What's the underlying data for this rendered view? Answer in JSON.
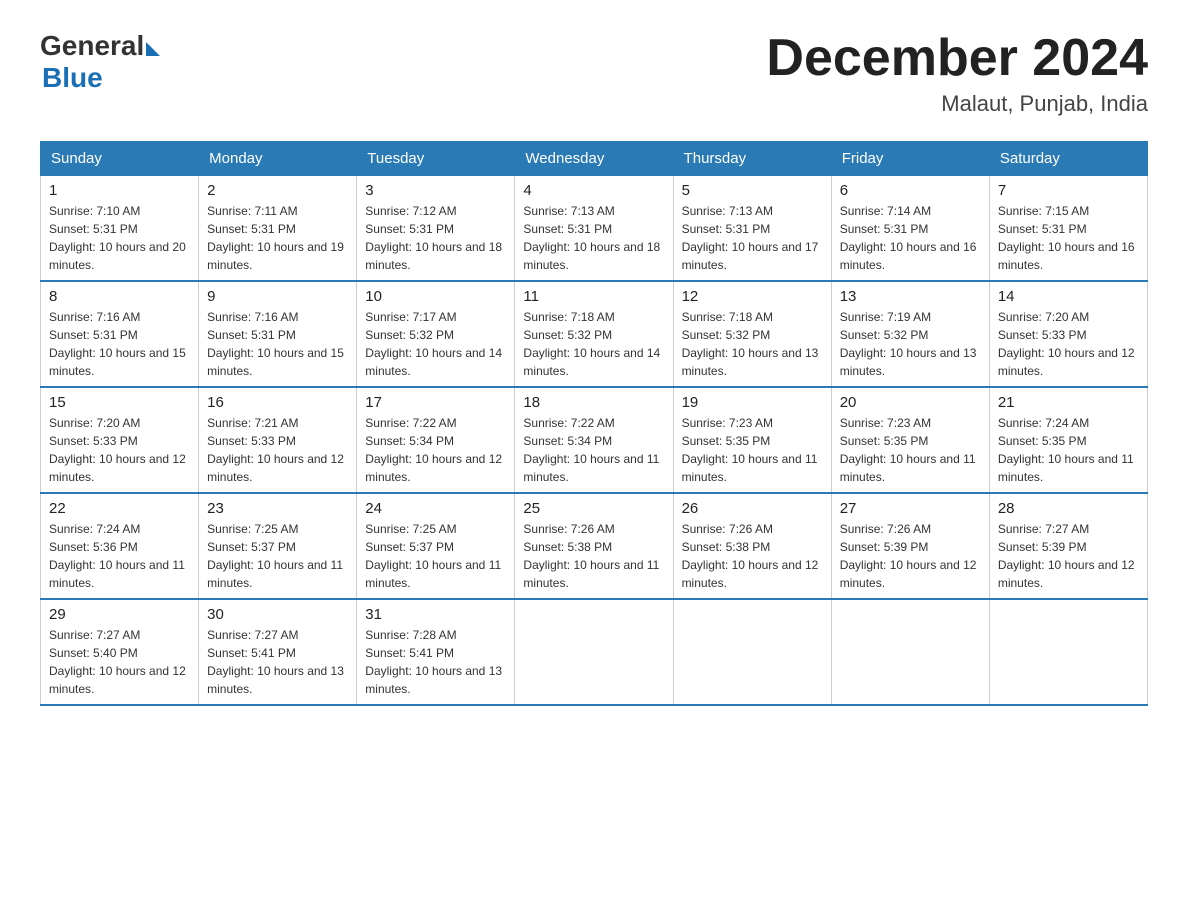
{
  "header": {
    "logo_general": "General",
    "logo_blue": "Blue",
    "month_title": "December 2024",
    "subtitle": "Malaut, Punjab, India"
  },
  "days_of_week": [
    "Sunday",
    "Monday",
    "Tuesday",
    "Wednesday",
    "Thursday",
    "Friday",
    "Saturday"
  ],
  "weeks": [
    [
      {
        "day": "1",
        "sunrise": "7:10 AM",
        "sunset": "5:31 PM",
        "daylight": "10 hours and 20 minutes."
      },
      {
        "day": "2",
        "sunrise": "7:11 AM",
        "sunset": "5:31 PM",
        "daylight": "10 hours and 19 minutes."
      },
      {
        "day": "3",
        "sunrise": "7:12 AM",
        "sunset": "5:31 PM",
        "daylight": "10 hours and 18 minutes."
      },
      {
        "day": "4",
        "sunrise": "7:13 AM",
        "sunset": "5:31 PM",
        "daylight": "10 hours and 18 minutes."
      },
      {
        "day": "5",
        "sunrise": "7:13 AM",
        "sunset": "5:31 PM",
        "daylight": "10 hours and 17 minutes."
      },
      {
        "day": "6",
        "sunrise": "7:14 AM",
        "sunset": "5:31 PM",
        "daylight": "10 hours and 16 minutes."
      },
      {
        "day": "7",
        "sunrise": "7:15 AM",
        "sunset": "5:31 PM",
        "daylight": "10 hours and 16 minutes."
      }
    ],
    [
      {
        "day": "8",
        "sunrise": "7:16 AM",
        "sunset": "5:31 PM",
        "daylight": "10 hours and 15 minutes."
      },
      {
        "day": "9",
        "sunrise": "7:16 AM",
        "sunset": "5:31 PM",
        "daylight": "10 hours and 15 minutes."
      },
      {
        "day": "10",
        "sunrise": "7:17 AM",
        "sunset": "5:32 PM",
        "daylight": "10 hours and 14 minutes."
      },
      {
        "day": "11",
        "sunrise": "7:18 AM",
        "sunset": "5:32 PM",
        "daylight": "10 hours and 14 minutes."
      },
      {
        "day": "12",
        "sunrise": "7:18 AM",
        "sunset": "5:32 PM",
        "daylight": "10 hours and 13 minutes."
      },
      {
        "day": "13",
        "sunrise": "7:19 AM",
        "sunset": "5:32 PM",
        "daylight": "10 hours and 13 minutes."
      },
      {
        "day": "14",
        "sunrise": "7:20 AM",
        "sunset": "5:33 PM",
        "daylight": "10 hours and 12 minutes."
      }
    ],
    [
      {
        "day": "15",
        "sunrise": "7:20 AM",
        "sunset": "5:33 PM",
        "daylight": "10 hours and 12 minutes."
      },
      {
        "day": "16",
        "sunrise": "7:21 AM",
        "sunset": "5:33 PM",
        "daylight": "10 hours and 12 minutes."
      },
      {
        "day": "17",
        "sunrise": "7:22 AM",
        "sunset": "5:34 PM",
        "daylight": "10 hours and 12 minutes."
      },
      {
        "day": "18",
        "sunrise": "7:22 AM",
        "sunset": "5:34 PM",
        "daylight": "10 hours and 11 minutes."
      },
      {
        "day": "19",
        "sunrise": "7:23 AM",
        "sunset": "5:35 PM",
        "daylight": "10 hours and 11 minutes."
      },
      {
        "day": "20",
        "sunrise": "7:23 AM",
        "sunset": "5:35 PM",
        "daylight": "10 hours and 11 minutes."
      },
      {
        "day": "21",
        "sunrise": "7:24 AM",
        "sunset": "5:35 PM",
        "daylight": "10 hours and 11 minutes."
      }
    ],
    [
      {
        "day": "22",
        "sunrise": "7:24 AM",
        "sunset": "5:36 PM",
        "daylight": "10 hours and 11 minutes."
      },
      {
        "day": "23",
        "sunrise": "7:25 AM",
        "sunset": "5:37 PM",
        "daylight": "10 hours and 11 minutes."
      },
      {
        "day": "24",
        "sunrise": "7:25 AM",
        "sunset": "5:37 PM",
        "daylight": "10 hours and 11 minutes."
      },
      {
        "day": "25",
        "sunrise": "7:26 AM",
        "sunset": "5:38 PM",
        "daylight": "10 hours and 11 minutes."
      },
      {
        "day": "26",
        "sunrise": "7:26 AM",
        "sunset": "5:38 PM",
        "daylight": "10 hours and 12 minutes."
      },
      {
        "day": "27",
        "sunrise": "7:26 AM",
        "sunset": "5:39 PM",
        "daylight": "10 hours and 12 minutes."
      },
      {
        "day": "28",
        "sunrise": "7:27 AM",
        "sunset": "5:39 PM",
        "daylight": "10 hours and 12 minutes."
      }
    ],
    [
      {
        "day": "29",
        "sunrise": "7:27 AM",
        "sunset": "5:40 PM",
        "daylight": "10 hours and 12 minutes."
      },
      {
        "day": "30",
        "sunrise": "7:27 AM",
        "sunset": "5:41 PM",
        "daylight": "10 hours and 13 minutes."
      },
      {
        "day": "31",
        "sunrise": "7:28 AM",
        "sunset": "5:41 PM",
        "daylight": "10 hours and 13 minutes."
      },
      {
        "day": "",
        "sunrise": "",
        "sunset": "",
        "daylight": ""
      },
      {
        "day": "",
        "sunrise": "",
        "sunset": "",
        "daylight": ""
      },
      {
        "day": "",
        "sunrise": "",
        "sunset": "",
        "daylight": ""
      },
      {
        "day": "",
        "sunrise": "",
        "sunset": "",
        "daylight": ""
      }
    ]
  ]
}
